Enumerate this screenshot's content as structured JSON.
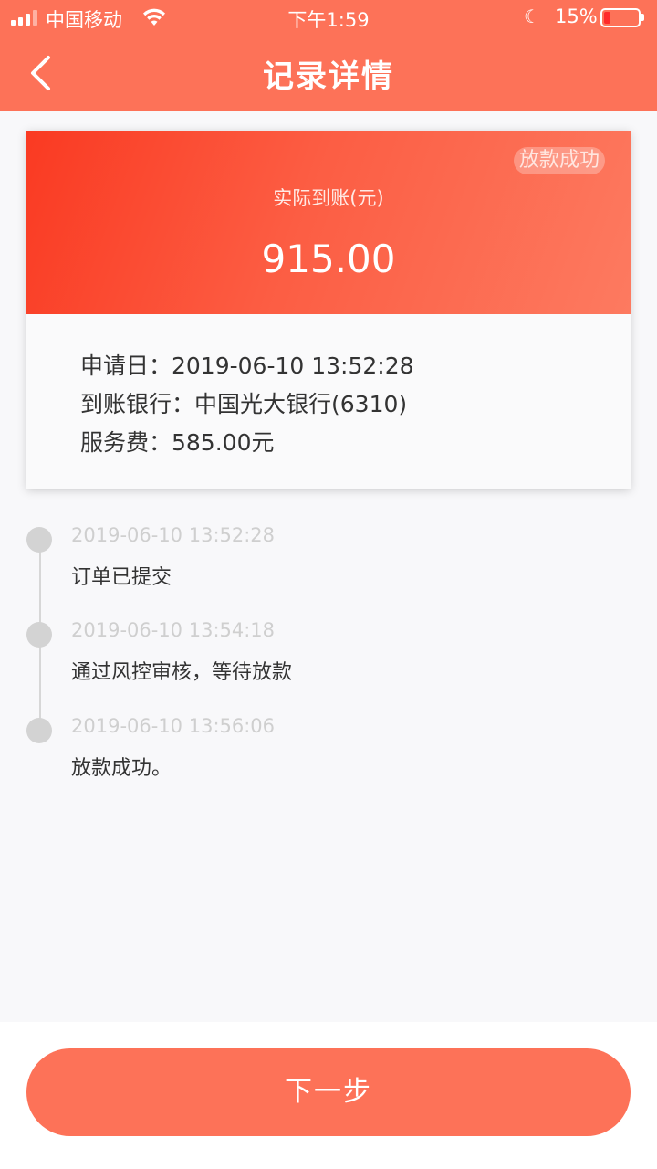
{
  "status_bar": {
    "carrier": "中国移动",
    "time": "下午1:59",
    "battery": "15%"
  },
  "header": {
    "title": "记录详情",
    "back_icon": "chevron-left-icon"
  },
  "summary": {
    "status_badge": "放款成功",
    "amount_label": "实际到账(元)",
    "amount": "915.00",
    "info": [
      "申请日：2019-06-10 13:52:28",
      "到账银行：中国光大银行(6310)",
      "服务费：585.00元"
    ]
  },
  "timeline": [
    {
      "time": "2019-06-10 13:52:28",
      "desc": "订单已提交"
    },
    {
      "time": "2019-06-10 13:54:18",
      "desc": "通过风控审核，等待放款"
    },
    {
      "time": "2019-06-10 13:56:06",
      "desc": "放款成功。"
    }
  ],
  "footer": {
    "next_label": "下一步"
  },
  "colors": {
    "header": "#fd7258",
    "card_gradient_start": "#fa3a22",
    "card_gradient_end": "#fd7a60",
    "button": "#fd7258"
  }
}
